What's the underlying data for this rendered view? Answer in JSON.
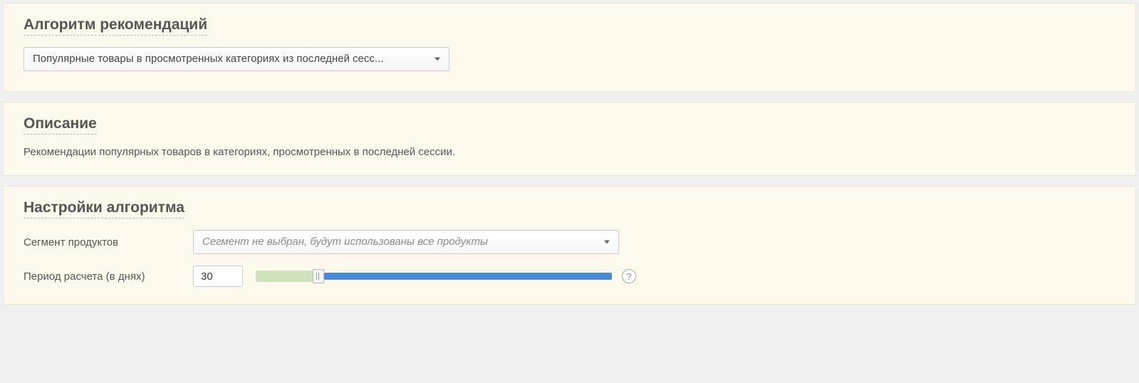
{
  "algorithm": {
    "title": "Алгоритм рекомендаций",
    "selected": "Популярные товары в просмотренных категориях из последней сесс..."
  },
  "description": {
    "title": "Описание",
    "text": "Рекомендации популярных товаров в категориях, просмотренных в последней сессии."
  },
  "settings": {
    "title": "Настройки алгоритма",
    "segment_label": "Сегмент продуктов",
    "segment_placeholder": "Сегмент не выбран, будут использованы все продукты",
    "period_label": "Период расчета (в днях)",
    "period_value": "30"
  }
}
